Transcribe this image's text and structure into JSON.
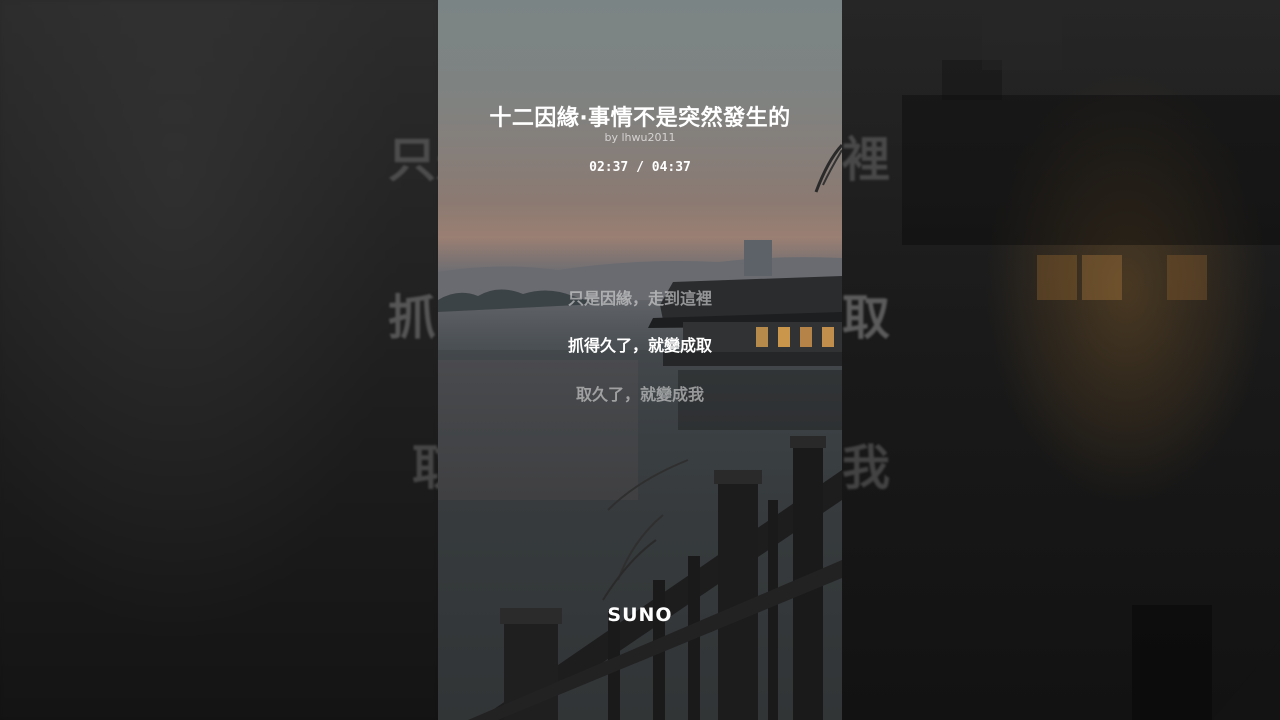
{
  "song": {
    "title": "十二因緣·事情不是突然發生的",
    "artist": "by lhwu2011",
    "time": "02:37 / 04:37"
  },
  "lyrics": {
    "previous": "只是因緣，走到這裡",
    "current": "抓得久了，就變成取",
    "next": "取久了，就變成我"
  },
  "backdrop": {
    "left_1": "只是",
    "left_2": "抓",
    "left_3": "取",
    "right_1": "裡",
    "right_2": "取",
    "right_3": "我"
  },
  "brand": {
    "logo": "SUNO"
  },
  "colors": {
    "background": "#151515",
    "text_primary": "#ffffff",
    "text_dim": "#b4b4b4"
  }
}
